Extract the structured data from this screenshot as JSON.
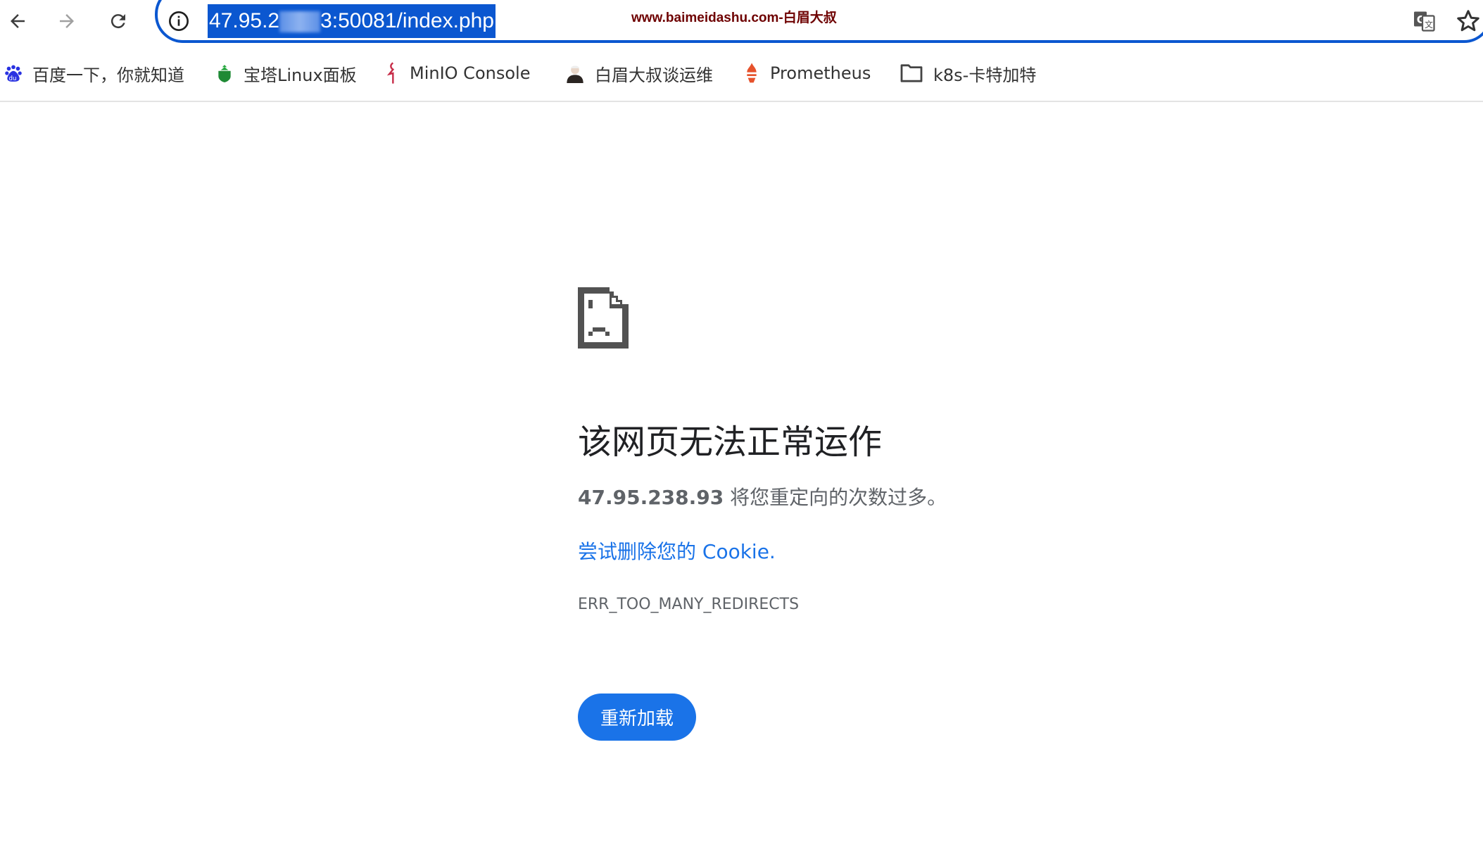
{
  "toolbar": {
    "url_visible_start": "47.95.2",
    "url_visible_end": "3:50081/index.php",
    "watermark": "www.baimeidashu.com-白眉大叔",
    "icons": [
      "back-arrow-icon",
      "forward-arrow-icon",
      "reload-icon",
      "info-icon",
      "translate-icon",
      "star-icon"
    ]
  },
  "bookmarks": [
    {
      "label": "百度一下，你就知道",
      "icon": "baidu-paw-icon"
    },
    {
      "label": "宝塔Linux面板",
      "icon": "bt-panel-icon"
    },
    {
      "label": "MinIO Console",
      "icon": "minio-icon"
    },
    {
      "label": "白眉大叔谈运维",
      "icon": "avatar-icon"
    },
    {
      "label": "Prometheus",
      "icon": "prometheus-torch-icon"
    },
    {
      "label": "k8s-卡特加特",
      "icon": "folder-icon"
    }
  ],
  "error": {
    "title": "该网页无法正常运作",
    "host": "47.95.238.93",
    "message": " 将您重定向的次数过多。",
    "link": "尝试删除您的 Cookie.",
    "code": "ERR_TOO_MANY_REDIRECTS",
    "reload_button": "重新加载"
  },
  "colors": {
    "accent": "#1a73e8",
    "omnibox_border": "#0b57d0",
    "watermark": "#6e0000"
  }
}
